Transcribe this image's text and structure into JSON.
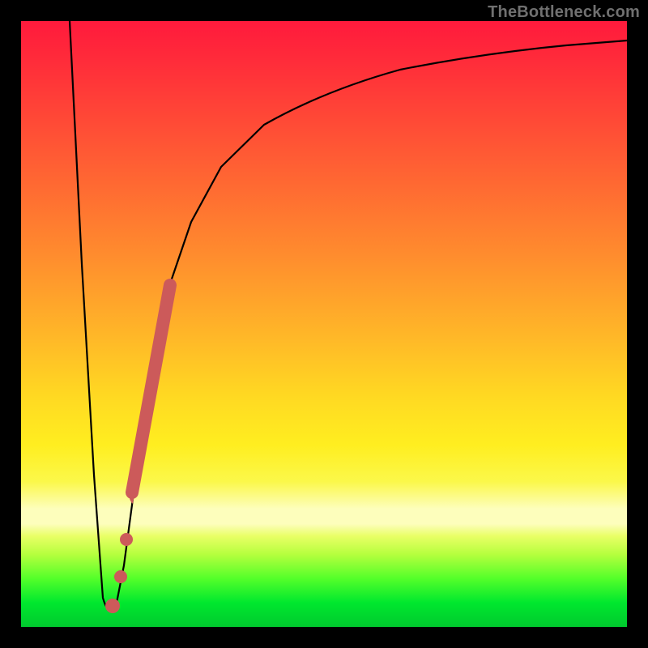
{
  "watermark": "TheBottleneck.com",
  "colors": {
    "background": "#000000",
    "gradient_top": "#ff1a3c",
    "gradient_mid": "#ffd922",
    "gradient_pale": "#fdfebc",
    "gradient_bottom": "#00c92e",
    "curve": "#000000",
    "marker": "#cc5a5a",
    "watermark": "#707070"
  },
  "chart_data": {
    "type": "line",
    "title": "",
    "xlabel": "",
    "ylabel": "",
    "xlim": [
      0,
      100
    ],
    "ylim": [
      0,
      100
    ],
    "grid": false,
    "series": [
      {
        "name": "bottleneck-curve",
        "x": [
          8,
          10,
          12,
          13.5,
          15,
          17,
          19,
          21,
          24,
          28,
          33,
          40,
          50,
          62,
          76,
          90,
          100
        ],
        "values": [
          100,
          60,
          25,
          5,
          3,
          10,
          25,
          40,
          55,
          67,
          76,
          83,
          88.5,
          92,
          94.5,
          96,
          97
        ]
      }
    ],
    "markers": [
      {
        "name": "highlight-segment",
        "x": [
          18.5,
          24.5
        ],
        "y": [
          23,
          57
        ],
        "shape": "thick-line"
      },
      {
        "name": "highlight-dot-1",
        "x": [
          17.0
        ],
        "y": [
          13
        ],
        "shape": "dot"
      },
      {
        "name": "highlight-dot-2",
        "x": [
          16.0
        ],
        "y": [
          7
        ],
        "shape": "dot"
      },
      {
        "name": "highlight-dot-3",
        "x": [
          14.5
        ],
        "y": [
          3
        ],
        "shape": "dot"
      }
    ],
    "annotations": [
      {
        "text": "TheBottleneck.com",
        "position": "top-right"
      }
    ]
  }
}
